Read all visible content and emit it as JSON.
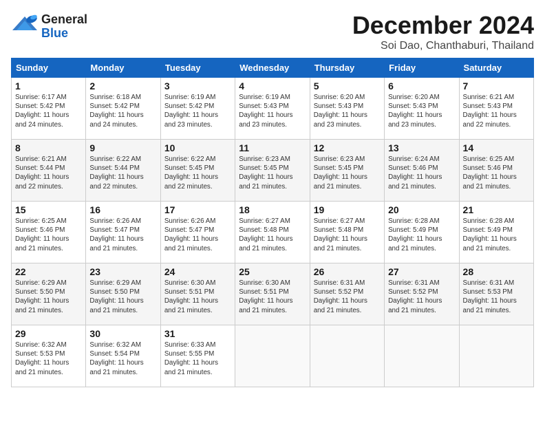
{
  "header": {
    "logo_general": "General",
    "logo_blue": "Blue",
    "month_title": "December 2024",
    "location": "Soi Dao, Chanthaburi, Thailand"
  },
  "days_of_week": [
    "Sunday",
    "Monday",
    "Tuesday",
    "Wednesday",
    "Thursday",
    "Friday",
    "Saturday"
  ],
  "weeks": [
    [
      {
        "day": "1",
        "info": "Sunrise: 6:17 AM\nSunset: 5:42 PM\nDaylight: 11 hours\nand 24 minutes."
      },
      {
        "day": "2",
        "info": "Sunrise: 6:18 AM\nSunset: 5:42 PM\nDaylight: 11 hours\nand 24 minutes."
      },
      {
        "day": "3",
        "info": "Sunrise: 6:19 AM\nSunset: 5:42 PM\nDaylight: 11 hours\nand 23 minutes."
      },
      {
        "day": "4",
        "info": "Sunrise: 6:19 AM\nSunset: 5:43 PM\nDaylight: 11 hours\nand 23 minutes."
      },
      {
        "day": "5",
        "info": "Sunrise: 6:20 AM\nSunset: 5:43 PM\nDaylight: 11 hours\nand 23 minutes."
      },
      {
        "day": "6",
        "info": "Sunrise: 6:20 AM\nSunset: 5:43 PM\nDaylight: 11 hours\nand 23 minutes."
      },
      {
        "day": "7",
        "info": "Sunrise: 6:21 AM\nSunset: 5:43 PM\nDaylight: 11 hours\nand 22 minutes."
      }
    ],
    [
      {
        "day": "8",
        "info": "Sunrise: 6:21 AM\nSunset: 5:44 PM\nDaylight: 11 hours\nand 22 minutes."
      },
      {
        "day": "9",
        "info": "Sunrise: 6:22 AM\nSunset: 5:44 PM\nDaylight: 11 hours\nand 22 minutes."
      },
      {
        "day": "10",
        "info": "Sunrise: 6:22 AM\nSunset: 5:45 PM\nDaylight: 11 hours\nand 22 minutes."
      },
      {
        "day": "11",
        "info": "Sunrise: 6:23 AM\nSunset: 5:45 PM\nDaylight: 11 hours\nand 21 minutes."
      },
      {
        "day": "12",
        "info": "Sunrise: 6:23 AM\nSunset: 5:45 PM\nDaylight: 11 hours\nand 21 minutes."
      },
      {
        "day": "13",
        "info": "Sunrise: 6:24 AM\nSunset: 5:46 PM\nDaylight: 11 hours\nand 21 minutes."
      },
      {
        "day": "14",
        "info": "Sunrise: 6:25 AM\nSunset: 5:46 PM\nDaylight: 11 hours\nand 21 minutes."
      }
    ],
    [
      {
        "day": "15",
        "info": "Sunrise: 6:25 AM\nSunset: 5:46 PM\nDaylight: 11 hours\nand 21 minutes."
      },
      {
        "day": "16",
        "info": "Sunrise: 6:26 AM\nSunset: 5:47 PM\nDaylight: 11 hours\nand 21 minutes."
      },
      {
        "day": "17",
        "info": "Sunrise: 6:26 AM\nSunset: 5:47 PM\nDaylight: 11 hours\nand 21 minutes."
      },
      {
        "day": "18",
        "info": "Sunrise: 6:27 AM\nSunset: 5:48 PM\nDaylight: 11 hours\nand 21 minutes."
      },
      {
        "day": "19",
        "info": "Sunrise: 6:27 AM\nSunset: 5:48 PM\nDaylight: 11 hours\nand 21 minutes."
      },
      {
        "day": "20",
        "info": "Sunrise: 6:28 AM\nSunset: 5:49 PM\nDaylight: 11 hours\nand 21 minutes."
      },
      {
        "day": "21",
        "info": "Sunrise: 6:28 AM\nSunset: 5:49 PM\nDaylight: 11 hours\nand 21 minutes."
      }
    ],
    [
      {
        "day": "22",
        "info": "Sunrise: 6:29 AM\nSunset: 5:50 PM\nDaylight: 11 hours\nand 21 minutes."
      },
      {
        "day": "23",
        "info": "Sunrise: 6:29 AM\nSunset: 5:50 PM\nDaylight: 11 hours\nand 21 minutes."
      },
      {
        "day": "24",
        "info": "Sunrise: 6:30 AM\nSunset: 5:51 PM\nDaylight: 11 hours\nand 21 minutes."
      },
      {
        "day": "25",
        "info": "Sunrise: 6:30 AM\nSunset: 5:51 PM\nDaylight: 11 hours\nand 21 minutes."
      },
      {
        "day": "26",
        "info": "Sunrise: 6:31 AM\nSunset: 5:52 PM\nDaylight: 11 hours\nand 21 minutes."
      },
      {
        "day": "27",
        "info": "Sunrise: 6:31 AM\nSunset: 5:52 PM\nDaylight: 11 hours\nand 21 minutes."
      },
      {
        "day": "28",
        "info": "Sunrise: 6:31 AM\nSunset: 5:53 PM\nDaylight: 11 hours\nand 21 minutes."
      }
    ],
    [
      {
        "day": "29",
        "info": "Sunrise: 6:32 AM\nSunset: 5:53 PM\nDaylight: 11 hours\nand 21 minutes."
      },
      {
        "day": "30",
        "info": "Sunrise: 6:32 AM\nSunset: 5:54 PM\nDaylight: 11 hours\nand 21 minutes."
      },
      {
        "day": "31",
        "info": "Sunrise: 6:33 AM\nSunset: 5:55 PM\nDaylight: 11 hours\nand 21 minutes."
      },
      {
        "day": "",
        "info": ""
      },
      {
        "day": "",
        "info": ""
      },
      {
        "day": "",
        "info": ""
      },
      {
        "day": "",
        "info": ""
      }
    ]
  ]
}
